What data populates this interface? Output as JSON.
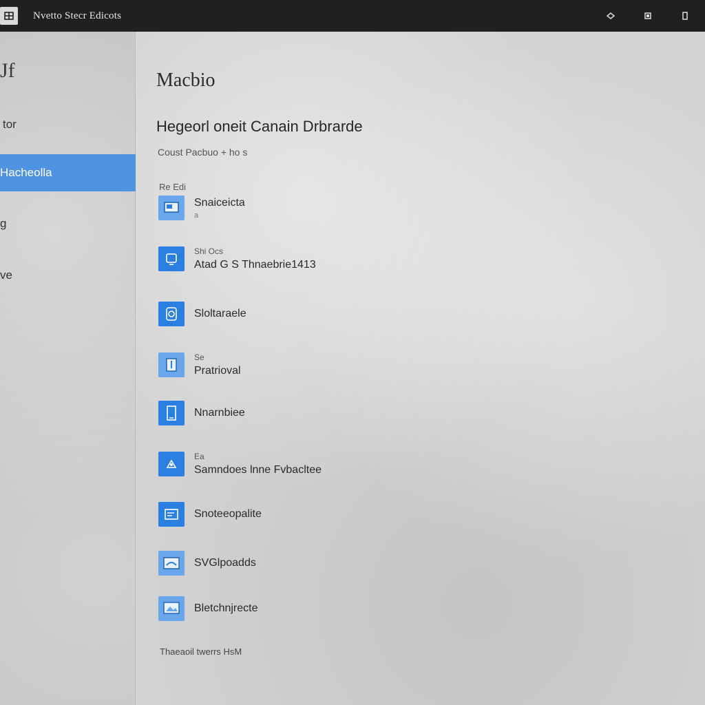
{
  "window": {
    "title": "Nvetto Stecr Edicots"
  },
  "sidebar": {
    "heading": "Jf",
    "items": [
      {
        "label": "tor"
      },
      {
        "label": "Hacheolla"
      },
      {
        "label": "g"
      },
      {
        "label": "ve"
      }
    ]
  },
  "main": {
    "title": "Macbio",
    "subtitle": "Hegeorl oneit Canain Drbrarde",
    "caption": "Coust Pacbuo + ho s",
    "section_label": "Re Edi",
    "settings": [
      {
        "small": "",
        "label": "Snaiceicta",
        "sub": "a"
      },
      {
        "small": "Shi Ocs",
        "label": "Atad G S Thnaebrie1413",
        "sub": ""
      },
      {
        "small": "",
        "label": "Sloltaraele",
        "sub": ""
      },
      {
        "small": "Se",
        "label": "Pratrioval",
        "sub": ""
      },
      {
        "small": "",
        "label": "Nnarnbiee",
        "sub": ""
      },
      {
        "small": "Ea",
        "label": "Samndoes lnne Fvbacltee",
        "sub": ""
      },
      {
        "small": "",
        "label": "Snoteeopalite",
        "sub": ""
      },
      {
        "small": "",
        "label": "SVGlpoadds",
        "sub": ""
      },
      {
        "small": "",
        "label": "Bletchnjrecte",
        "sub": ""
      }
    ],
    "footer": "Thaeaoil twerrs HsM"
  }
}
